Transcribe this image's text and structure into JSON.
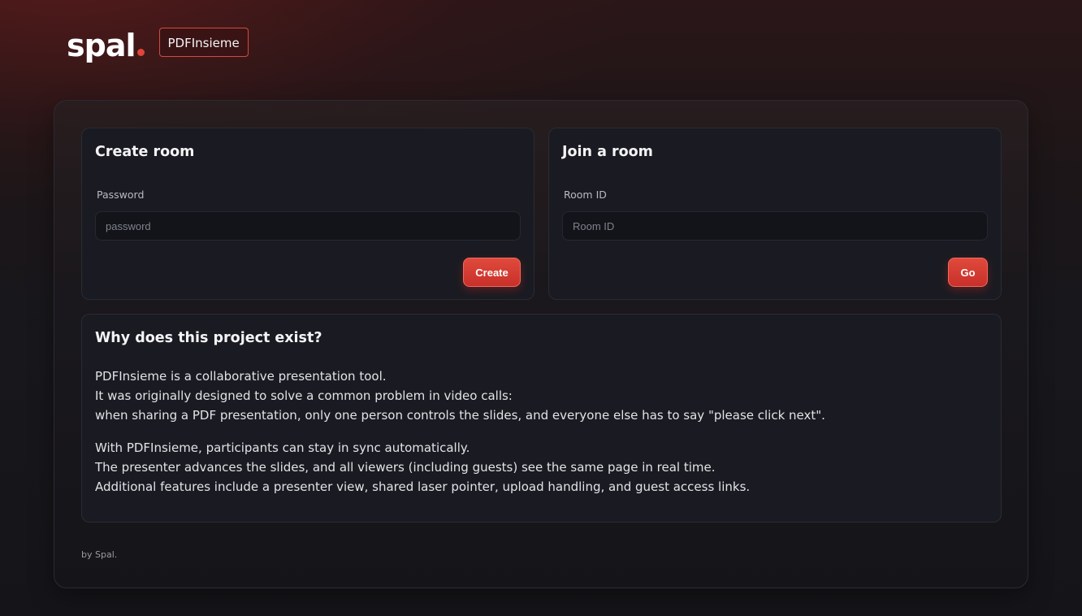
{
  "header": {
    "logo_text": "spal",
    "app_badge": "PDFInsieme"
  },
  "create_room": {
    "title": "Create room",
    "field_label": "Password",
    "input_placeholder": "password",
    "input_value": "",
    "button_label": "Create"
  },
  "join_room": {
    "title": "Join a room",
    "field_label": "Room ID",
    "input_placeholder": "Room ID",
    "input_value": "",
    "button_label": "Go"
  },
  "about": {
    "title": "Why does this project exist?",
    "paragraphs": [
      {
        "lines": [
          "PDFInsieme is a collaborative presentation tool.",
          "It was originally designed to solve a common problem in video calls:",
          "when sharing a PDF presentation, only one person controls the slides, and everyone else has to say \"please click next\"."
        ]
      },
      {
        "lines": [
          "With PDFInsieme, participants can stay in sync automatically.",
          "The presenter advances the slides, and all viewers (including guests) see the same page in real time.",
          "Additional features include a presenter view, shared laser pointer, upload handling, and guest access links."
        ]
      }
    ]
  },
  "footer": {
    "text": "by Spal."
  },
  "colors": {
    "accent": "#e0453a",
    "button_top": "#e04a3c",
    "button_bottom": "#c8302a",
    "card_bg": "#1a1b22",
    "input_bg": "#121419"
  }
}
